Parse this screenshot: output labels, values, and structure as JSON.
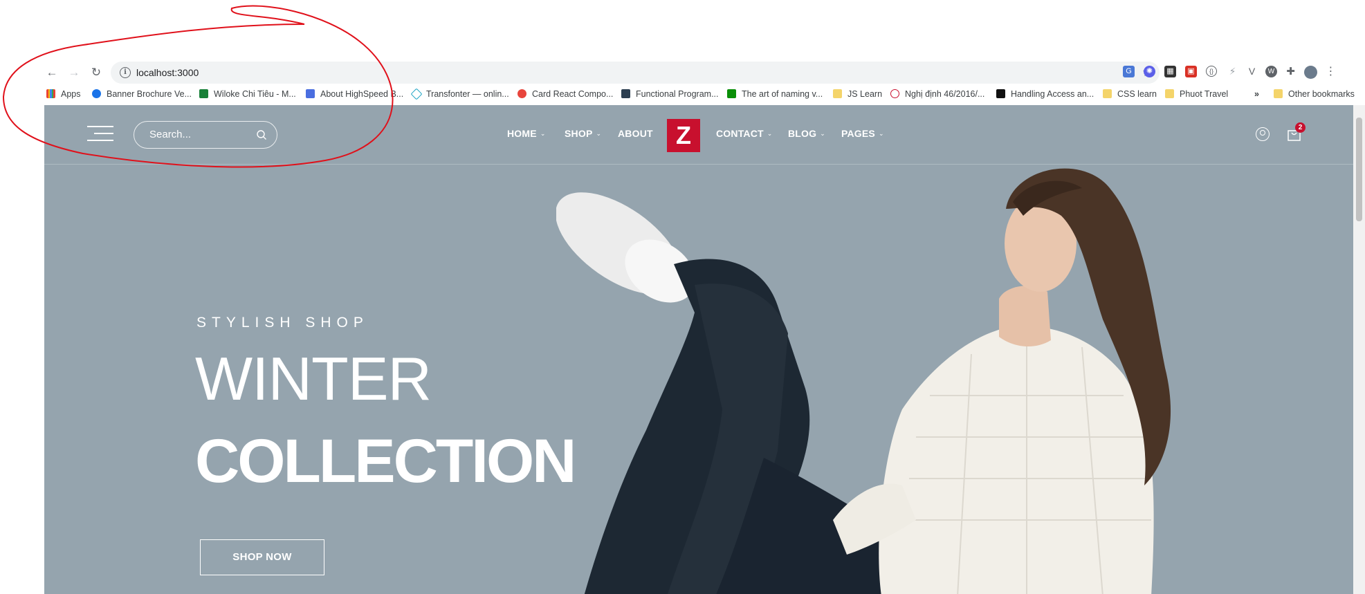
{
  "browser": {
    "url": "localhost:3000",
    "bookmarks": [
      {
        "label": "Apps",
        "color": "#4285f4"
      },
      {
        "label": "Banner Brochure Ve...",
        "color": "#1a73e8"
      },
      {
        "label": "Wiloke Chi Tiêu - M...",
        "color": "#188038"
      },
      {
        "label": "About HighSpeed B...",
        "color": "#4a6ee0"
      },
      {
        "label": "Transfonter — onlin...",
        "color": "#1aa3c4"
      },
      {
        "label": "Card React Compo...",
        "color": "#e8453c"
      },
      {
        "label": "Functional Program...",
        "color": "#2c3e50"
      },
      {
        "label": "The art of naming v...",
        "color": "#0a8f08"
      },
      {
        "label": "JS Learn",
        "color": "#f4d46a"
      },
      {
        "label": "Nghị định 46/2016/...",
        "color": "#c8102e"
      },
      {
        "label": "Handling Access an...",
        "color": "#111111"
      },
      {
        "label": "CSS learn",
        "color": "#f4d46a"
      },
      {
        "label": "Phuot Travel",
        "color": "#f4d46a"
      }
    ],
    "overflow": "»",
    "other_bookmarks": "Other bookmarks"
  },
  "site": {
    "search_placeholder": "Search...",
    "nav": {
      "home": "HOME",
      "shop": "SHOP",
      "about": "ABOUT",
      "contact": "CONTACT",
      "blog": "BLOG",
      "pages": "PAGES"
    },
    "logo": "Z",
    "cart_count": "2",
    "hero": {
      "eyebrow": "STYLISH SHOP",
      "title_light": "WINTER",
      "title_bold": "COLLECTION",
      "cta": "SHOP NOW"
    }
  },
  "colors": {
    "hero_bg": "#95a4ae",
    "accent": "#c8102e",
    "annotation": "#e0101a"
  }
}
